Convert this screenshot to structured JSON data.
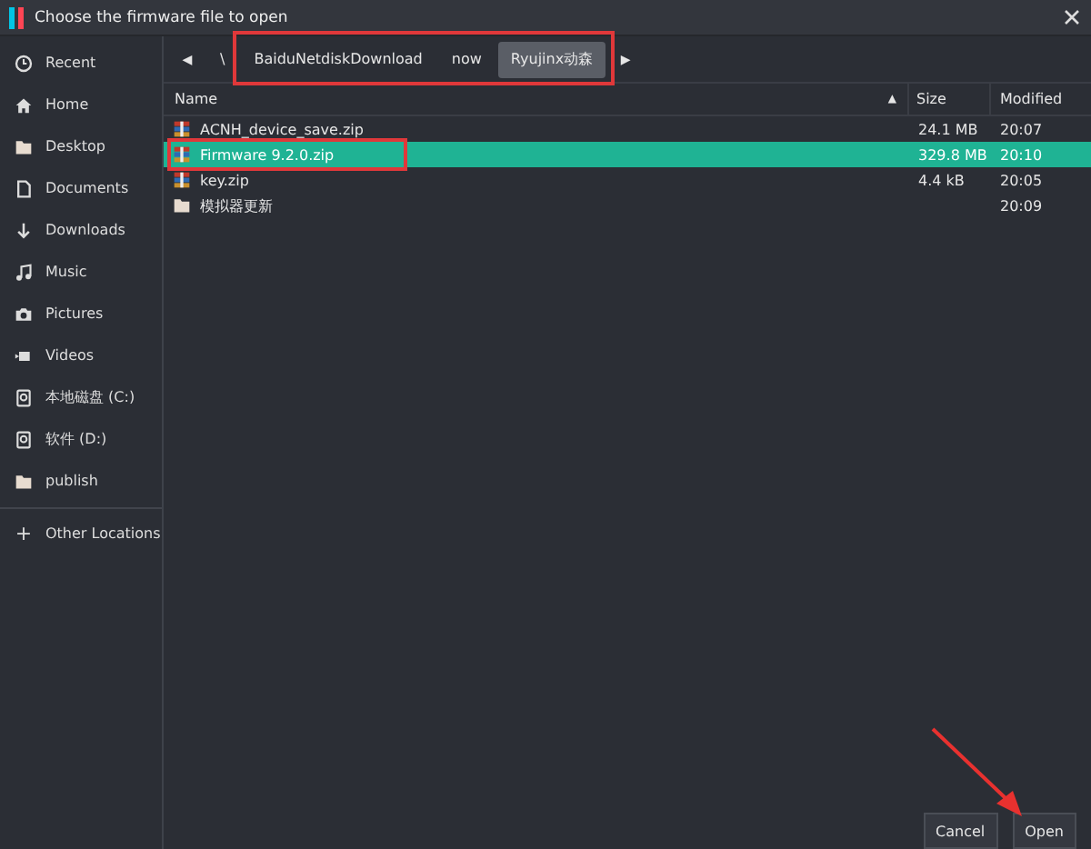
{
  "window": {
    "title": "Choose the firmware file to open"
  },
  "sidebar": {
    "items": [
      {
        "label": "Recent",
        "kind": "clock"
      },
      {
        "label": "Home",
        "kind": "home"
      },
      {
        "label": "Desktop",
        "kind": "folder"
      },
      {
        "label": "Documents",
        "kind": "doc"
      },
      {
        "label": "Downloads",
        "kind": "download"
      },
      {
        "label": "Music",
        "kind": "music"
      },
      {
        "label": "Pictures",
        "kind": "camera"
      },
      {
        "label": "Videos",
        "kind": "video"
      },
      {
        "label": "本地磁盘 (C:)",
        "kind": "drive"
      },
      {
        "label": "软件 (D:)",
        "kind": "drive"
      },
      {
        "label": "publish",
        "kind": "folder"
      }
    ],
    "other": {
      "label": "Other Locations",
      "icon": "+"
    }
  },
  "path": {
    "back": "◀",
    "forward": "▶",
    "segments": [
      {
        "label": "\\",
        "selected": false
      },
      {
        "label": "BaiduNetdiskDownload",
        "selected": false
      },
      {
        "label": "now",
        "selected": false
      },
      {
        "label": "Ryujinx动森",
        "selected": true
      }
    ]
  },
  "table": {
    "columns": [
      "Name",
      "Size",
      "Modified"
    ],
    "sort": "▲",
    "rows": [
      {
        "name": "ACNH_device_save.zip",
        "kind": "archive",
        "size": "24.1 MB",
        "modified": "20:07",
        "selected": false
      },
      {
        "name": "Firmware 9.2.0.zip",
        "kind": "archive",
        "size": "329.8 MB",
        "modified": "20:10",
        "selected": true
      },
      {
        "name": "key.zip",
        "kind": "archive",
        "size": "4.4 kB",
        "modified": "20:05",
        "selected": false
      },
      {
        "name": "模拟器更新",
        "kind": "folder",
        "size": "",
        "modified": "20:09",
        "selected": false
      }
    ]
  },
  "buttons": [
    "Cancel",
    "Open"
  ]
}
